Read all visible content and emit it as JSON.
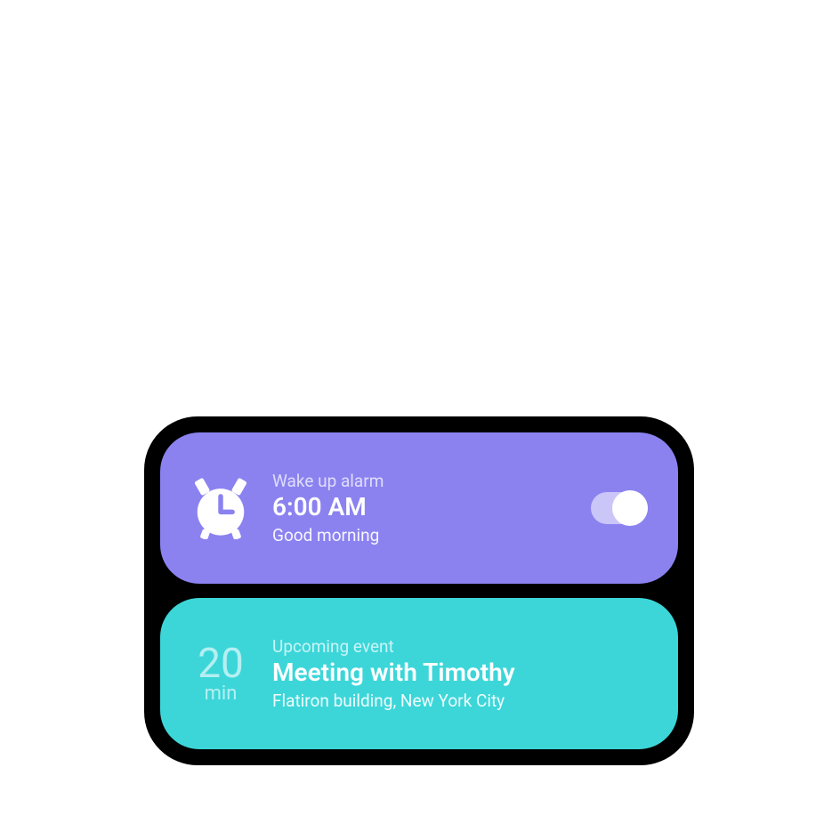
{
  "alarm": {
    "label": "Wake up alarm",
    "time": "6:00 AM",
    "message": "Good morning",
    "toggle_on": true
  },
  "event": {
    "countdown_value": "20",
    "countdown_unit": "min",
    "label": "Upcoming event",
    "title": "Meeting with Timothy",
    "location": "Flatiron building, New York City"
  },
  "colors": {
    "alarm_bg": "#8b82f0",
    "event_bg": "#3cd6d9",
    "device_bg": "#000000"
  }
}
